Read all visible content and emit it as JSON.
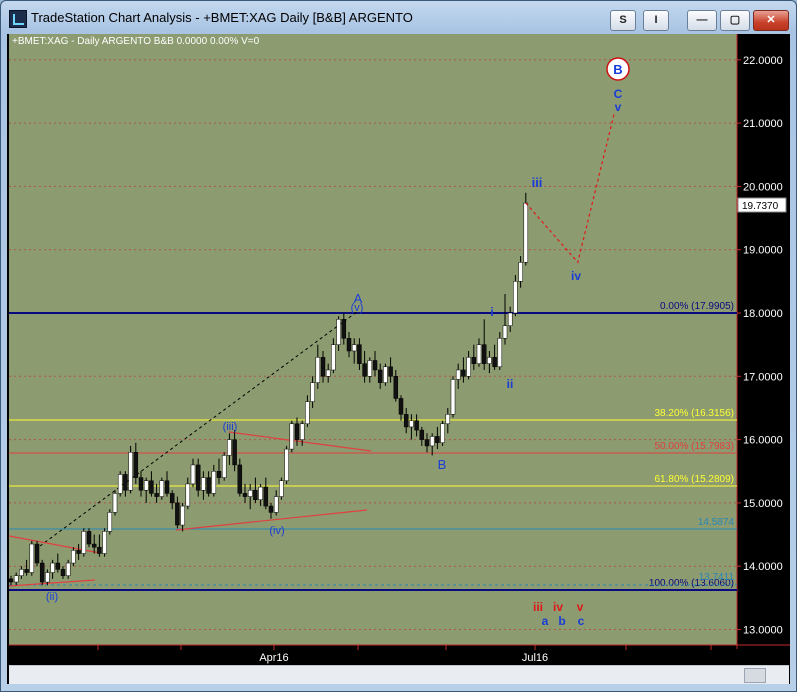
{
  "window": {
    "title": "TradeStation Chart Analysis - +BMET:XAG Daily [B&B] ARGENTO",
    "s_button": "S",
    "i_button": "I",
    "minimize": "—",
    "maximize": "▢",
    "close": "✕"
  },
  "status_line": "+BMET:XAG - Daily  ARGENTO  B&B  0.0000  0.00%  V=0",
  "colors": {
    "plot_bg": "#8c9b70",
    "axis_red": "#c22a2a",
    "fib_yellow": "#ffff33",
    "fib_red": "#e04040",
    "navy": "#0a0a80",
    "teal": "#2888b8",
    "wave_blue": "#1a3cd8"
  },
  "chart_data": {
    "type": "candlestick",
    "symbol": "+BMET:XAG",
    "interval": "Daily",
    "last_price_label": "19.7370",
    "y_ticks": [
      "22.0000",
      "21.0000",
      "20.0000",
      "19.0000",
      "18.0000",
      "17.0000",
      "16.0000",
      "15.0000",
      "14.0000",
      "13.0000"
    ],
    "ylim": [
      12.7,
      22.4
    ],
    "x_ticks": [
      "Apr16",
      "Jul16"
    ],
    "fib_levels": [
      {
        "label": "0.00% (17.9905)",
        "price": 17.9905,
        "color": "navy"
      },
      {
        "label": "38.20% (16.3156)",
        "price": 16.3156,
        "color": "yellow"
      },
      {
        "label": "50.00% (15.7983)",
        "price": 15.7983,
        "color": "red"
      },
      {
        "label": "61.80% (15.2809)",
        "price": 15.2809,
        "color": "yellow"
      },
      {
        "label": "100.00% (13.6060)",
        "price": 13.606,
        "color": "navy"
      }
    ],
    "support_levels": [
      {
        "label": "14.5874",
        "price": 14.5874
      },
      {
        "label": "13.7411",
        "price": 13.7411
      }
    ],
    "candles": [
      [
        13.8,
        13.85,
        13.7,
        13.75
      ],
      [
        13.75,
        13.9,
        13.7,
        13.85
      ],
      [
        13.85,
        14.0,
        13.8,
        13.95
      ],
      [
        13.95,
        14.1,
        13.85,
        13.9
      ],
      [
        13.9,
        14.4,
        13.85,
        14.35
      ],
      [
        14.35,
        14.4,
        14.0,
        14.05
      ],
      [
        14.05,
        14.1,
        13.7,
        13.75
      ],
      [
        13.75,
        13.95,
        13.7,
        13.9
      ],
      [
        13.9,
        14.1,
        13.8,
        14.05
      ],
      [
        14.05,
        14.2,
        13.9,
        13.95
      ],
      [
        13.95,
        14.0,
        13.8,
        13.85
      ],
      [
        13.85,
        14.1,
        13.8,
        14.05
      ],
      [
        14.05,
        14.3,
        14.0,
        14.25
      ],
      [
        14.25,
        14.35,
        14.1,
        14.2
      ],
      [
        14.2,
        14.6,
        14.15,
        14.55
      ],
      [
        14.55,
        14.6,
        14.3,
        14.35
      ],
      [
        14.35,
        14.5,
        14.2,
        14.3
      ],
      [
        14.3,
        14.5,
        14.15,
        14.2
      ],
      [
        14.2,
        14.6,
        14.15,
        14.55
      ],
      [
        14.55,
        14.9,
        14.5,
        14.85
      ],
      [
        14.85,
        15.2,
        14.8,
        15.15
      ],
      [
        15.15,
        15.5,
        15.1,
        15.45
      ],
      [
        15.45,
        15.5,
        15.1,
        15.2
      ],
      [
        15.2,
        15.9,
        15.15,
        15.8
      ],
      [
        15.8,
        15.95,
        15.3,
        15.4
      ],
      [
        15.4,
        15.5,
        15.1,
        15.2
      ],
      [
        15.2,
        15.4,
        15.0,
        15.35
      ],
      [
        15.35,
        15.5,
        15.1,
        15.15
      ],
      [
        15.15,
        15.3,
        15.0,
        15.1
      ],
      [
        15.1,
        15.4,
        15.05,
        15.35
      ],
      [
        15.35,
        15.5,
        15.1,
        15.15
      ],
      [
        15.15,
        15.2,
        14.9,
        15.0
      ],
      [
        15.0,
        15.1,
        14.6,
        14.65
      ],
      [
        14.65,
        15.0,
        14.55,
        14.95
      ],
      [
        14.95,
        15.4,
        14.9,
        15.3
      ],
      [
        15.3,
        15.7,
        15.25,
        15.6
      ],
      [
        15.6,
        15.7,
        15.1,
        15.2
      ],
      [
        15.2,
        15.5,
        15.05,
        15.4
      ],
      [
        15.4,
        15.5,
        15.1,
        15.15
      ],
      [
        15.15,
        15.6,
        15.1,
        15.5
      ],
      [
        15.5,
        15.7,
        15.3,
        15.4
      ],
      [
        15.4,
        15.8,
        15.35,
        15.75
      ],
      [
        15.75,
        16.1,
        15.6,
        16.0
      ],
      [
        16.0,
        16.15,
        15.5,
        15.6
      ],
      [
        15.6,
        15.7,
        15.1,
        15.15
      ],
      [
        15.15,
        15.3,
        15.0,
        15.1
      ],
      [
        15.1,
        15.3,
        14.9,
        15.2
      ],
      [
        15.2,
        15.4,
        15.0,
        15.05
      ],
      [
        15.05,
        15.3,
        14.95,
        15.25
      ],
      [
        15.25,
        15.4,
        14.9,
        14.95
      ],
      [
        14.95,
        15.0,
        14.75,
        14.85
      ],
      [
        14.85,
        15.2,
        14.8,
        15.1
      ],
      [
        15.1,
        15.4,
        15.05,
        15.35
      ],
      [
        15.35,
        15.9,
        15.3,
        15.85
      ],
      [
        15.85,
        16.3,
        15.8,
        16.25
      ],
      [
        16.25,
        16.35,
        15.9,
        16.0
      ],
      [
        16.0,
        16.3,
        15.9,
        16.25
      ],
      [
        16.25,
        16.7,
        16.2,
        16.6
      ],
      [
        16.6,
        17.0,
        16.5,
        16.9
      ],
      [
        16.9,
        17.5,
        16.8,
        17.3
      ],
      [
        17.3,
        17.4,
        16.9,
        17.0
      ],
      [
        17.0,
        17.2,
        16.9,
        17.1
      ],
      [
        17.1,
        17.6,
        17.05,
        17.5
      ],
      [
        17.5,
        17.95,
        17.4,
        17.9
      ],
      [
        17.9,
        18.0,
        17.5,
        17.6
      ],
      [
        17.6,
        17.7,
        17.3,
        17.4
      ],
      [
        17.4,
        17.6,
        17.2,
        17.5
      ],
      [
        17.5,
        17.6,
        17.1,
        17.2
      ],
      [
        17.2,
        17.4,
        16.9,
        17.0
      ],
      [
        17.0,
        17.3,
        16.9,
        17.25
      ],
      [
        17.25,
        17.4,
        17.0,
        17.1
      ],
      [
        17.1,
        17.2,
        16.8,
        16.9
      ],
      [
        16.9,
        17.2,
        16.85,
        17.15
      ],
      [
        17.15,
        17.3,
        16.9,
        17.0
      ],
      [
        17.0,
        17.1,
        16.6,
        16.65
      ],
      [
        16.65,
        16.7,
        16.3,
        16.4
      ],
      [
        16.4,
        16.5,
        16.1,
        16.2
      ],
      [
        16.2,
        16.4,
        16.0,
        16.3
      ],
      [
        16.3,
        16.4,
        16.05,
        16.15
      ],
      [
        16.15,
        16.2,
        15.9,
        16.0
      ],
      [
        16.0,
        16.1,
        15.8,
        15.9
      ],
      [
        15.9,
        16.1,
        15.75,
        16.05
      ],
      [
        16.05,
        16.2,
        15.85,
        15.95
      ],
      [
        15.95,
        16.3,
        15.9,
        16.25
      ],
      [
        16.25,
        16.5,
        16.1,
        16.4
      ],
      [
        16.4,
        17.0,
        16.35,
        16.95
      ],
      [
        16.95,
        17.2,
        16.8,
        17.1
      ],
      [
        17.1,
        17.3,
        16.9,
        17.0
      ],
      [
        17.0,
        17.4,
        16.95,
        17.3
      ],
      [
        17.3,
        17.5,
        17.1,
        17.2
      ],
      [
        17.2,
        17.6,
        17.15,
        17.5
      ],
      [
        17.5,
        17.9,
        17.1,
        17.2
      ],
      [
        17.2,
        17.4,
        17.05,
        17.3
      ],
      [
        17.3,
        17.5,
        17.1,
        17.15
      ],
      [
        17.15,
        17.7,
        17.1,
        17.6
      ],
      [
        17.6,
        18.3,
        17.5,
        17.8
      ],
      [
        17.8,
        18.1,
        17.7,
        18.0
      ],
      [
        18.0,
        18.6,
        17.95,
        18.5
      ],
      [
        18.5,
        18.9,
        18.4,
        18.8
      ],
      [
        18.8,
        19.9,
        18.75,
        19.737
      ]
    ],
    "wave_labels": [
      {
        "text": "A",
        "color": "blue"
      },
      {
        "text": "(v)",
        "color": "blue"
      },
      {
        "text": "(iii)",
        "color": "blue"
      },
      {
        "text": "(iv)",
        "color": "blue"
      },
      {
        "text": "(ii)",
        "color": "blue"
      },
      {
        "text": "B",
        "color": "blue"
      },
      {
        "text": "i",
        "color": "blue"
      },
      {
        "text": "ii",
        "color": "blue"
      },
      {
        "text": "iii",
        "color": "blue"
      },
      {
        "text": "iv",
        "color": "blue"
      },
      {
        "text": "v",
        "color": "blue"
      },
      {
        "text": "C",
        "color": "blue"
      },
      {
        "text": "B",
        "color": "circled"
      }
    ],
    "legend_rows": {
      "red": [
        "iii",
        "iv",
        "v"
      ],
      "blue": [
        "a",
        "b",
        "c"
      ]
    },
    "projection_path": [
      [
        99,
        19.737
      ],
      [
        109,
        18.8
      ],
      [
        116,
        21.15
      ]
    ]
  }
}
